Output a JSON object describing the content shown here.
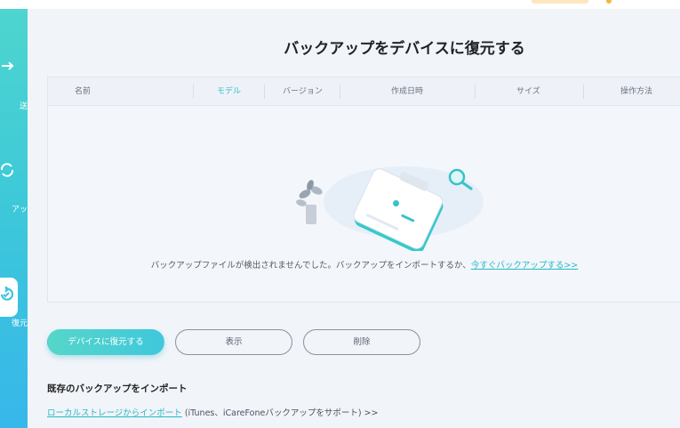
{
  "header": {
    "title": "バックアップをデバイスに復元する"
  },
  "sidebar": {
    "items": [
      {
        "label": "送",
        "icon": "transfer-icon"
      },
      {
        "label": "アッ",
        "icon": "backup-icon"
      },
      {
        "label": "復元",
        "icon": "restore-icon",
        "active": true
      }
    ]
  },
  "table": {
    "columns": [
      "名前",
      "モデル",
      "バージョン",
      "作成日時",
      "サイズ",
      "操作方法"
    ],
    "active_column": "モデル",
    "rows": []
  },
  "empty_state": {
    "message": "バックアップファイルが検出されませんでした。バックアップをインポートするか、",
    "link": "今すぐバックアップする>>"
  },
  "actions": {
    "restore_label": "デバイスに復元する",
    "view_label": "表示",
    "delete_label": "削除"
  },
  "import": {
    "title": "既存のバックアップをインポート",
    "link": "ローカルストレージからインポート",
    "note": " (iTunes、iCareFoneバックアップをサポート) >>"
  },
  "colors": {
    "accent": "#2fc3c3",
    "sidebar_top": "#4ed5cf",
    "sidebar_bottom": "#37b7ea",
    "background": "#f1f4f9"
  }
}
